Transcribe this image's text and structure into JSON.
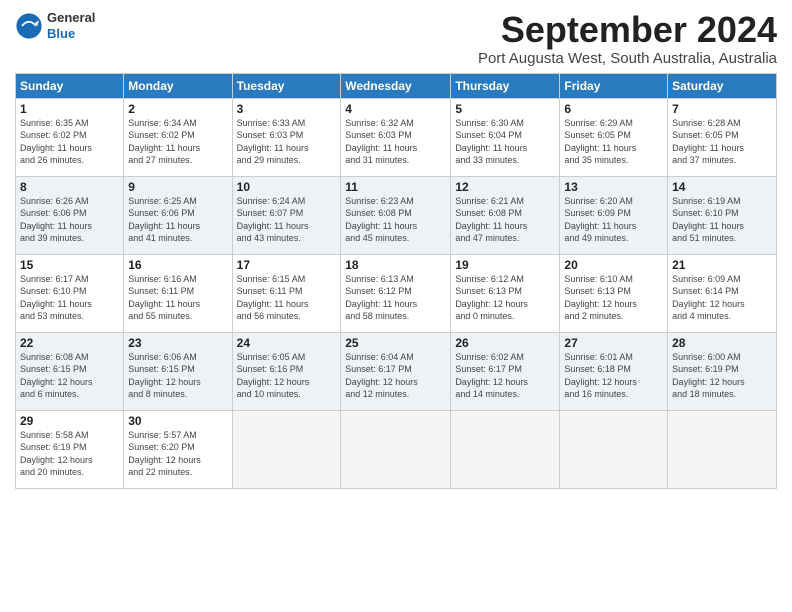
{
  "logo": {
    "general": "General",
    "blue": "Blue"
  },
  "title": "September 2024",
  "location": "Port Augusta West, South Australia, Australia",
  "weekdays": [
    "Sunday",
    "Monday",
    "Tuesday",
    "Wednesday",
    "Thursday",
    "Friday",
    "Saturday"
  ],
  "weeks": [
    [
      {
        "day": "1",
        "info": "Sunrise: 6:35 AM\nSunset: 6:02 PM\nDaylight: 11 hours\nand 26 minutes."
      },
      {
        "day": "2",
        "info": "Sunrise: 6:34 AM\nSunset: 6:02 PM\nDaylight: 11 hours\nand 27 minutes."
      },
      {
        "day": "3",
        "info": "Sunrise: 6:33 AM\nSunset: 6:03 PM\nDaylight: 11 hours\nand 29 minutes."
      },
      {
        "day": "4",
        "info": "Sunrise: 6:32 AM\nSunset: 6:03 PM\nDaylight: 11 hours\nand 31 minutes."
      },
      {
        "day": "5",
        "info": "Sunrise: 6:30 AM\nSunset: 6:04 PM\nDaylight: 11 hours\nand 33 minutes."
      },
      {
        "day": "6",
        "info": "Sunrise: 6:29 AM\nSunset: 6:05 PM\nDaylight: 11 hours\nand 35 minutes."
      },
      {
        "day": "7",
        "info": "Sunrise: 6:28 AM\nSunset: 6:05 PM\nDaylight: 11 hours\nand 37 minutes."
      }
    ],
    [
      {
        "day": "8",
        "info": "Sunrise: 6:26 AM\nSunset: 6:06 PM\nDaylight: 11 hours\nand 39 minutes."
      },
      {
        "day": "9",
        "info": "Sunrise: 6:25 AM\nSunset: 6:06 PM\nDaylight: 11 hours\nand 41 minutes."
      },
      {
        "day": "10",
        "info": "Sunrise: 6:24 AM\nSunset: 6:07 PM\nDaylight: 11 hours\nand 43 minutes."
      },
      {
        "day": "11",
        "info": "Sunrise: 6:23 AM\nSunset: 6:08 PM\nDaylight: 11 hours\nand 45 minutes."
      },
      {
        "day": "12",
        "info": "Sunrise: 6:21 AM\nSunset: 6:08 PM\nDaylight: 11 hours\nand 47 minutes."
      },
      {
        "day": "13",
        "info": "Sunrise: 6:20 AM\nSunset: 6:09 PM\nDaylight: 11 hours\nand 49 minutes."
      },
      {
        "day": "14",
        "info": "Sunrise: 6:19 AM\nSunset: 6:10 PM\nDaylight: 11 hours\nand 51 minutes."
      }
    ],
    [
      {
        "day": "15",
        "info": "Sunrise: 6:17 AM\nSunset: 6:10 PM\nDaylight: 11 hours\nand 53 minutes."
      },
      {
        "day": "16",
        "info": "Sunrise: 6:16 AM\nSunset: 6:11 PM\nDaylight: 11 hours\nand 55 minutes."
      },
      {
        "day": "17",
        "info": "Sunrise: 6:15 AM\nSunset: 6:11 PM\nDaylight: 11 hours\nand 56 minutes."
      },
      {
        "day": "18",
        "info": "Sunrise: 6:13 AM\nSunset: 6:12 PM\nDaylight: 11 hours\nand 58 minutes."
      },
      {
        "day": "19",
        "info": "Sunrise: 6:12 AM\nSunset: 6:13 PM\nDaylight: 12 hours\nand 0 minutes."
      },
      {
        "day": "20",
        "info": "Sunrise: 6:10 AM\nSunset: 6:13 PM\nDaylight: 12 hours\nand 2 minutes."
      },
      {
        "day": "21",
        "info": "Sunrise: 6:09 AM\nSunset: 6:14 PM\nDaylight: 12 hours\nand 4 minutes."
      }
    ],
    [
      {
        "day": "22",
        "info": "Sunrise: 6:08 AM\nSunset: 6:15 PM\nDaylight: 12 hours\nand 6 minutes."
      },
      {
        "day": "23",
        "info": "Sunrise: 6:06 AM\nSunset: 6:15 PM\nDaylight: 12 hours\nand 8 minutes."
      },
      {
        "day": "24",
        "info": "Sunrise: 6:05 AM\nSunset: 6:16 PM\nDaylight: 12 hours\nand 10 minutes."
      },
      {
        "day": "25",
        "info": "Sunrise: 6:04 AM\nSunset: 6:17 PM\nDaylight: 12 hours\nand 12 minutes."
      },
      {
        "day": "26",
        "info": "Sunrise: 6:02 AM\nSunset: 6:17 PM\nDaylight: 12 hours\nand 14 minutes."
      },
      {
        "day": "27",
        "info": "Sunrise: 6:01 AM\nSunset: 6:18 PM\nDaylight: 12 hours\nand 16 minutes."
      },
      {
        "day": "28",
        "info": "Sunrise: 6:00 AM\nSunset: 6:19 PM\nDaylight: 12 hours\nand 18 minutes."
      }
    ],
    [
      {
        "day": "29",
        "info": "Sunrise: 5:58 AM\nSunset: 6:19 PM\nDaylight: 12 hours\nand 20 minutes."
      },
      {
        "day": "30",
        "info": "Sunrise: 5:57 AM\nSunset: 6:20 PM\nDaylight: 12 hours\nand 22 minutes."
      },
      {
        "day": "",
        "info": ""
      },
      {
        "day": "",
        "info": ""
      },
      {
        "day": "",
        "info": ""
      },
      {
        "day": "",
        "info": ""
      },
      {
        "day": "",
        "info": ""
      }
    ]
  ]
}
